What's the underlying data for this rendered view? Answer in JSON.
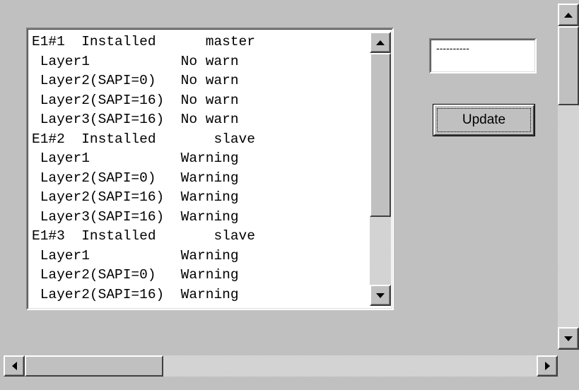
{
  "list": {
    "rows": [
      "E1#1  Installed      master",
      " Layer1           No warn",
      " Layer2(SAPI=0)   No warn",
      " Layer2(SAPI=16)  No warn",
      " Layer3(SAPI=16)  No warn",
      "E1#2  Installed       slave",
      " Layer1           Warning",
      " Layer2(SAPI=0)   Warning",
      " Layer2(SAPI=16)  Warning",
      " Layer3(SAPI=16)  Warning",
      "E1#3  Installed       slave",
      " Layer1           Warning",
      " Layer2(SAPI=0)   Warning",
      " Layer2(SAPI=16)  Warning"
    ]
  },
  "status_field": {
    "value": "----------"
  },
  "buttons": {
    "update_label": "Update"
  },
  "icons": {
    "scroll_up": "arrow-up-icon",
    "scroll_down": "arrow-down-icon",
    "scroll_left": "arrow-left-icon",
    "scroll_right": "arrow-right-icon"
  },
  "colors": {
    "window_background": "#c0c0c0",
    "list_background": "#ffffff",
    "text": "#000000"
  }
}
